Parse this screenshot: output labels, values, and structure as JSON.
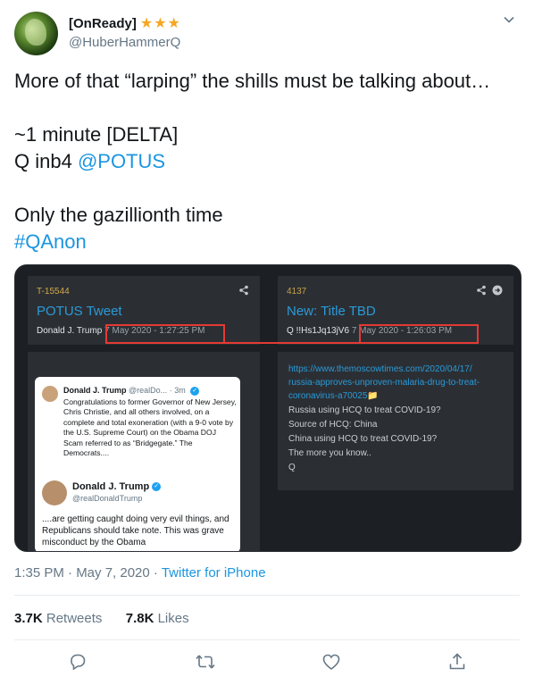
{
  "author": {
    "name": "[OnReady]",
    "stars": "★★★",
    "handle": "@HuberHammerQ"
  },
  "tweet": {
    "lines": [
      "More of that “larping” the shills must be talking about…",
      "",
      "~1 minute [DELTA]",
      "Q inb4 ",
      "",
      "Only the gazillionth time",
      "#QAnon"
    ],
    "mention": "@POTUS"
  },
  "media": {
    "left_panel": {
      "id": "T-15544",
      "title": "POTUS Tweet",
      "author": "Donald J. Trump",
      "timestamp": "7 May 2020 - 1:27:25 PM"
    },
    "right_panel": {
      "id": "4137",
      "title": "New: Title TBD",
      "author": "Q",
      "trip": "!!Hs1Jq13jV6",
      "timestamp": "7 May 2020 - 1:26:03 PM"
    },
    "embedded_tweet": {
      "name": "Donald J. Trump",
      "handle_short": "@realDo...",
      "time": "3m",
      "text": "Congratulations to former Governor of New Jersey, Chris Christie, and all others involved, on a complete and total exoneration (with a 9-0 vote by the U.S. Supreme Court) on the Obama DOJ Scam referred to as “Bridgegate.” The Democrats....",
      "name2": "Donald J. Trump",
      "handle2": "@realDonaldTrump",
      "text2": "....are getting caught doing very evil things, and Republicans should take note. This was grave misconduct by the Obama"
    },
    "right_body": [
      "https://www.themoscowtimes.com/2020/04/17/",
      "russia-approves-unproven-malaria-drug-to-treat-",
      "coronavirus-a70025📁",
      "Russia using HCQ to treat COVID-19?",
      "Source of HCQ: China",
      "China using HCQ to treat COVID-19?",
      "The more you know..",
      "Q"
    ]
  },
  "meta": {
    "time": "1:35 PM · May 7, 2020 · ",
    "source": "Twitter for iPhone"
  },
  "stats": {
    "retweets_count": "3.7K",
    "retweets_label": "Retweets",
    "likes_count": "7.8K",
    "likes_label": "Likes"
  },
  "colors": {
    "accent": "#1b95e0",
    "redbox": "#e53935",
    "star": "#f5a623"
  },
  "icons": [
    "chevron-down-icon",
    "share-icon",
    "reply-icon",
    "retweet-icon",
    "like-icon",
    "upload-icon"
  ]
}
